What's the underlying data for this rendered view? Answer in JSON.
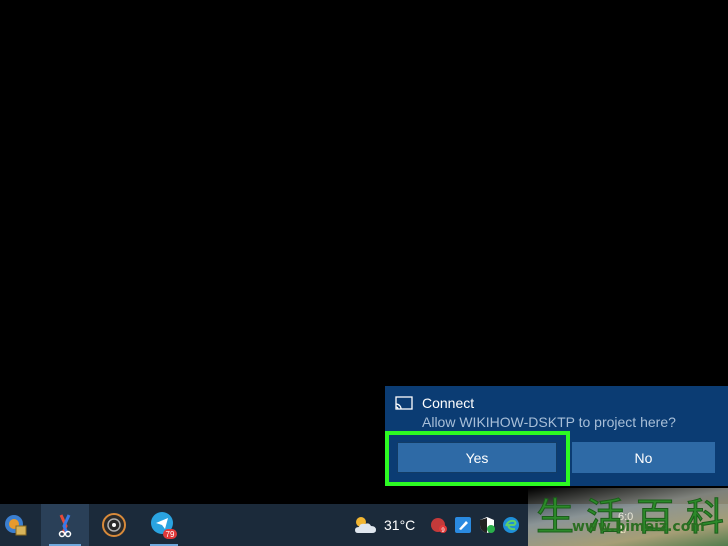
{
  "toast": {
    "title": "Connect",
    "message": "Allow WIKIHOW-DSKTP to project here?",
    "yes_label": "Yes",
    "no_label": "No",
    "icon": "cast-icon",
    "highlight_color": "#2dfa23"
  },
  "taskbar": {
    "apps": [
      {
        "icon": "control-panel-icon"
      },
      {
        "icon": "snipping-tool-icon",
        "active": true
      },
      {
        "icon": "media-player-icon"
      },
      {
        "icon": "telegram-icon",
        "badge": "79"
      }
    ],
    "weather": {
      "icon": "weather-partly-cloudy-icon",
      "temperature": "31°C"
    },
    "tray_icons": [
      "vpn-icon",
      "pen-icon",
      "security-icon",
      "edge-icon"
    ],
    "tray_badge": "9",
    "clock": {
      "time": "6:0",
      "date": "1/"
    }
  },
  "watermark": {
    "chars": [
      "生",
      "活",
      "百",
      "科"
    ],
    "url": "www.bimeiz.com"
  }
}
